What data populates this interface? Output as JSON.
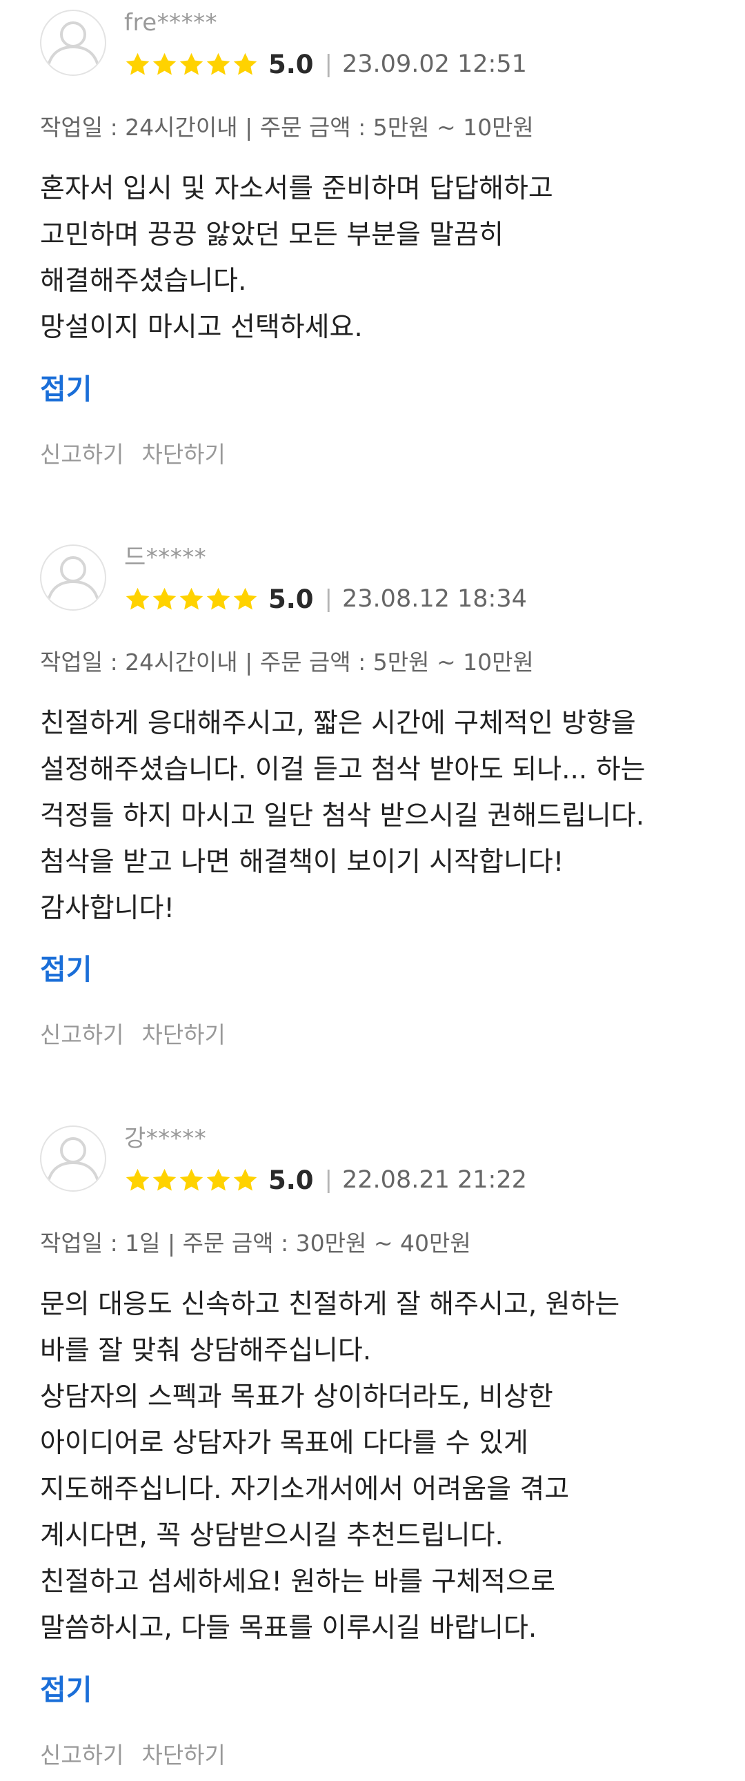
{
  "colors": {
    "star": "#ffd200",
    "link": "#1a6ed8",
    "muted": "#999999"
  },
  "reviews": [
    {
      "nickname": "fre*****",
      "score": "5.0",
      "date": "23.09.02 12:51",
      "meta": "작업일 : 24시간이내 | 주문 금액 : 5만원 ~ 10만원",
      "lines": [
        "혼자서 입시  및 자소서를 준비하며 답답해하고",
        "고민하며 끙끙 앓았던 모든 부분을 말끔히",
        "해결해주셨습니다.",
        "망설이지 마시고 선택하세요."
      ],
      "fold_label": "접기",
      "report_label": "신고하기",
      "block_label": "차단하기"
    },
    {
      "nickname": "드*****",
      "score": "5.0",
      "date": "23.08.12 18:34",
      "meta": "작업일 : 24시간이내 | 주문 금액 : 5만원 ~ 10만원",
      "lines": [
        "친절하게 응대해주시고, 짧은 시간에 구체적인 방향을",
        "설정해주셨습니다. 이걸 듣고 첨삭 받아도 되나... 하는",
        "걱정들 하지 마시고 일단 첨삭 받으시길 권해드립니다.",
        "첨삭을 받고 나면 해결책이 보이기 시작합니다!",
        "감사합니다!"
      ],
      "fold_label": "접기",
      "report_label": "신고하기",
      "block_label": "차단하기"
    },
    {
      "nickname": "강*****",
      "score": "5.0",
      "date": "22.08.21 21:22",
      "meta": "작업일 : 1일 | 주문 금액 : 30만원 ~ 40만원",
      "lines": [
        "문의 대응도 신속하고 친절하게 잘 해주시고, 원하는",
        "바를 잘 맞춰 상담해주십니다.",
        "상담자의 스펙과 목표가 상이하더라도, 비상한",
        "아이디어로 상담자가 목표에 다다를 수 있게",
        "지도해주십니다. 자기소개서에서 어려움을 겪고",
        "계시다면, 꼭 상담받으시길 추천드립니다.",
        "친절하고 섬세하세요! 원하는 바를 구체적으로",
        "말씀하시고, 다들 목표를 이루시길 바랍니다."
      ],
      "fold_label": "접기",
      "report_label": "신고하기",
      "block_label": "차단하기"
    }
  ]
}
